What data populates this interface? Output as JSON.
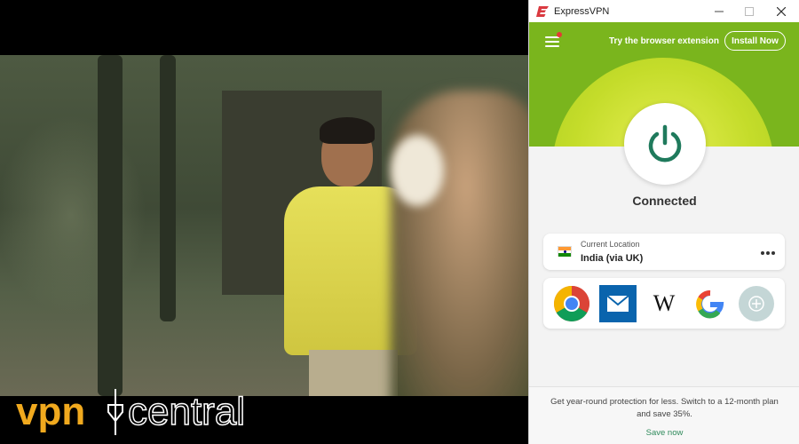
{
  "video": {
    "watermark": {
      "brand_left": "vpn",
      "brand_right": "central"
    }
  },
  "vpn_app": {
    "window_title": "ExpressVPN",
    "window_controls": [
      "minimize",
      "maximize",
      "close"
    ],
    "header": {
      "extension_promo": "Try the browser extension",
      "install_button": "Install Now"
    },
    "status": "Connected",
    "location": {
      "label": "Current Location",
      "value": "India (via UK)",
      "flag": "india-flag-icon"
    },
    "shortcuts": [
      {
        "name": "chrome-icon"
      },
      {
        "name": "mail-icon"
      },
      {
        "name": "wikipedia-icon",
        "text": "W"
      },
      {
        "name": "google-icon"
      },
      {
        "name": "add-shortcut-icon"
      }
    ],
    "promo": {
      "text": "Get year-round protection for less. Switch to a 12-month plan and save 35%.",
      "link": "Save now"
    },
    "colors": {
      "brand_red": "#da3940",
      "hero_green": "#7ab51d",
      "hero_yellow": "#e8ef55",
      "power_green": "#1f7a5c",
      "link_green": "#2f8a5b"
    }
  }
}
